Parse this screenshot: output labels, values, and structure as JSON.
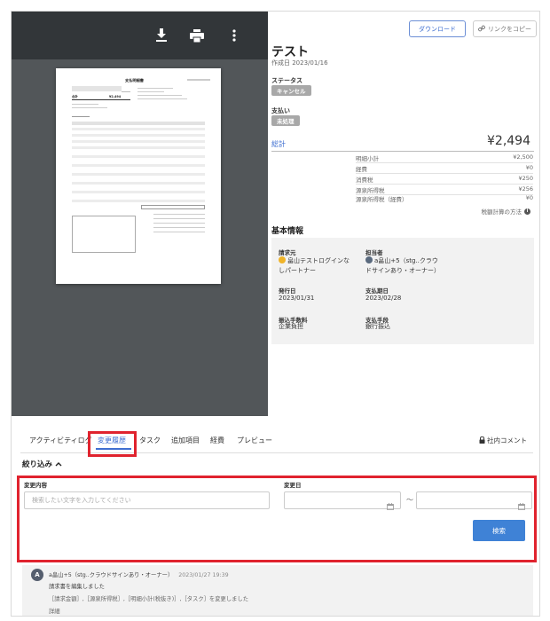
{
  "viewer": {
    "document": {
      "title": "支払明細書",
      "total_label": "合計",
      "total_amount": "¥2,494"
    }
  },
  "header": {
    "download_label": "ダウンロード",
    "copy_link_label": "リンクをコピー",
    "title": "テスト",
    "created": "作成日 2023/01/16"
  },
  "status": {
    "label": "ステータス",
    "value": "キャンセル"
  },
  "payment": {
    "label": "支払い",
    "value": "未処理"
  },
  "totals": {
    "label": "総計",
    "amount": "¥2,494",
    "breakdown": [
      {
        "label": "明細小計",
        "value": "¥2,500"
      },
      {
        "label": "経費",
        "value": "¥0"
      },
      {
        "label": "消費税",
        "value": "¥250"
      },
      {
        "label": "源泉所得税",
        "value": "¥256"
      },
      {
        "label": "源泉所得税（経費）",
        "value": "¥0"
      }
    ],
    "tax_method": "税額計算の方法"
  },
  "basic_info": {
    "title": "基本情報",
    "requester_label": "請求元",
    "requester_line1": "畠山テストログインな",
    "requester_line2": "しパートナー",
    "owner_label": "担当者",
    "owner_line1": "a畠山+5（stg..クラウ",
    "owner_line2": "ドサインあり・オーナー）",
    "issue_date_label": "発行日",
    "issue_date": "2023/01/31",
    "due_date_label": "支払期日",
    "due_date": "2023/02/28",
    "fee_label": "振込手数料",
    "fee": "企業負担",
    "method_label": "支払手段",
    "method": "銀行振込"
  },
  "tabs": [
    {
      "label": "アクティビティログ"
    },
    {
      "label": "変更履歴"
    },
    {
      "label": "タスク"
    },
    {
      "label": "追加項目"
    },
    {
      "label": "経費"
    },
    {
      "label": "プレビュー"
    }
  ],
  "internal_comment": "社内コメント",
  "filter": {
    "toggle": "絞り込み",
    "content_label": "変更内容",
    "search_placeholder": "検索したい文字を入力してください",
    "date_label": "変更日",
    "range_sep": "〜",
    "search_button": "検索"
  },
  "history": {
    "avatar": "A",
    "user": "a畠山+5（stg..クラウドサインあり・オーナー）",
    "time": "2023/01/27 19:39",
    "action": "請求書を編集しました",
    "changes": "［請求金額］,［源泉所得税］,［明細小計(税抜き)］,［タスク］を変更しました",
    "details": "詳細"
  }
}
